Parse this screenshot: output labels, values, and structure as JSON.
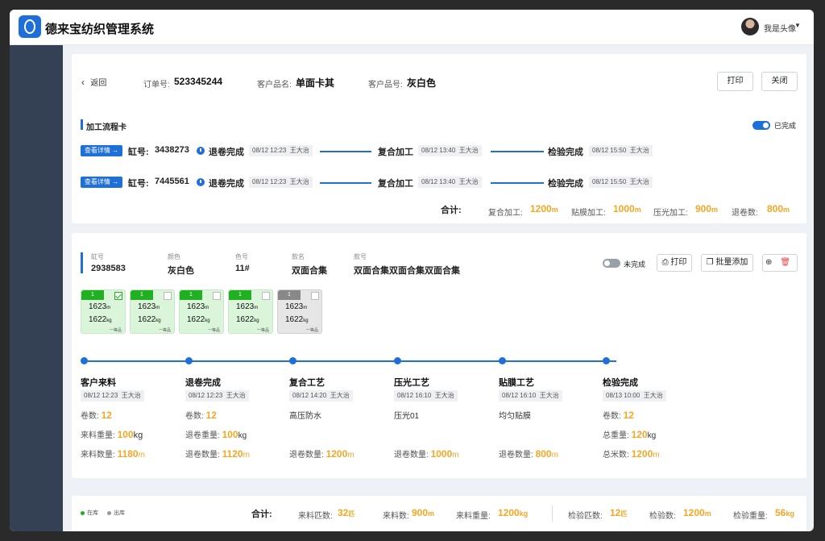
{
  "app": {
    "title": "德来宝纺织管理系统",
    "user": "我是头像"
  },
  "order": {
    "back_label": "返回",
    "order_no_label": "订单号:",
    "order_no": "523345244",
    "product_name_label": "客户品名:",
    "product_name": "单面卡其",
    "product_code_label": "客户品号:",
    "product_code": "灰白色",
    "print_label": "打印",
    "close_label": "关闭"
  },
  "process_card": {
    "title": "加工流程卡",
    "toggle_label": "已完成",
    "rows": [
      {
        "detail_btn": "查看详情 →",
        "vat_label": "缸号:",
        "vat_no": "3438273",
        "steps": [
          {
            "name": "退卷完成",
            "time": "08/12 12:23",
            "person": "王大治"
          },
          {
            "name": "复合加工",
            "time": "08/12 13:40",
            "person": "王大治"
          },
          {
            "name": "检验完成",
            "time": "08/12 15:50",
            "person": "王大治"
          }
        ]
      },
      {
        "detail_btn": "查看详情 →",
        "vat_label": "缸号:",
        "vat_no": "7445561",
        "steps": [
          {
            "name": "退卷完成",
            "time": "08/12 12:23",
            "person": "王大治"
          },
          {
            "name": "复合加工",
            "time": "08/12 13:40",
            "person": "王大治"
          },
          {
            "name": "检验完成",
            "time": "08/12 15:50",
            "person": "王大治"
          }
        ]
      }
    ],
    "total_label": "合计:",
    "totals": [
      {
        "label": "复合加工:",
        "value": "1200",
        "unit": "m"
      },
      {
        "label": "贴膜加工:",
        "value": "1000",
        "unit": "m"
      },
      {
        "label": "压光加工:",
        "value": "900",
        "unit": "m"
      },
      {
        "label": "退卷数:",
        "value": "800",
        "unit": "m"
      }
    ]
  },
  "vat_detail": {
    "fields": [
      {
        "label": "缸号",
        "value": "2938583"
      },
      {
        "label": "颜色",
        "value": "灰白色"
      },
      {
        "label": "色号",
        "value": "11#"
      },
      {
        "label": "款名",
        "value": "双面合集"
      },
      {
        "label": "款号",
        "value": "双面合集双面合集双面合集"
      }
    ],
    "toggle_label": "未完成",
    "print_label": "打印",
    "batch_add_label": "批量添加",
    "rolls": [
      {
        "num": "1",
        "length": "1623",
        "len_unit": "m",
        "weight": "1622",
        "wt_unit": "kg",
        "grade": "一等品",
        "checked": true,
        "status": "green"
      },
      {
        "num": "1",
        "length": "1623",
        "len_unit": "m",
        "weight": "1622",
        "wt_unit": "kg",
        "grade": "一等品",
        "checked": false,
        "status": "green"
      },
      {
        "num": "1",
        "length": "1623",
        "len_unit": "m",
        "weight": "1622",
        "wt_unit": "kg",
        "grade": "一等品",
        "checked": false,
        "status": "green"
      },
      {
        "num": "1",
        "length": "1623",
        "len_unit": "m",
        "weight": "1622",
        "wt_unit": "kg",
        "grade": "一等品",
        "checked": false,
        "status": "green"
      },
      {
        "num": "1",
        "length": "1623",
        "len_unit": "m",
        "weight": "1622",
        "wt_unit": "kg",
        "grade": "一等品",
        "checked": false,
        "status": "gray"
      }
    ],
    "steps": [
      {
        "title": "客户来料",
        "time": "08/12 12:23",
        "person": "王大治",
        "lines": [
          {
            "label": "卷数:",
            "value": "12",
            "unit": ""
          },
          {
            "label": "来料重量:",
            "value": "100",
            "unit": "kg"
          },
          {
            "label": "来料数量:",
            "value": "1180",
            "unit": "m"
          }
        ]
      },
      {
        "title": "退卷完成",
        "time": "08/12 12:23",
        "person": "王大治",
        "lines": [
          {
            "label": "卷数:",
            "value": "12",
            "unit": ""
          },
          {
            "label": "退卷重量:",
            "value": "100",
            "unit": "kg"
          },
          {
            "label": "退卷数量:",
            "value": "1120",
            "unit": "m"
          }
        ]
      },
      {
        "title": "复合工艺",
        "time": "08/12 14:20",
        "person": "王大治",
        "note": "高压防水",
        "lines": [
          {
            "label": "退卷数量:",
            "value": "1200",
            "unit": "m"
          }
        ]
      },
      {
        "title": "压光工艺",
        "time": "08/12 16:10",
        "person": "王大治",
        "note": "压光01",
        "lines": [
          {
            "label": "退卷数量:",
            "value": "1000",
            "unit": "m"
          }
        ]
      },
      {
        "title": "贴膜工艺",
        "time": "08/12 16:10",
        "person": "王大治",
        "note": "均匀贴膜",
        "lines": [
          {
            "label": "退卷数量:",
            "value": "800",
            "unit": "m"
          }
        ]
      },
      {
        "title": "检验完成",
        "time": "08/13 10:00",
        "person": "王大治",
        "lines": [
          {
            "label": "卷数:",
            "value": "12",
            "unit": ""
          },
          {
            "label": "总重量:",
            "value": "120",
            "unit": "kg"
          },
          {
            "label": "总米数:",
            "value": "1200",
            "unit": "m"
          }
        ]
      }
    ]
  },
  "footer": {
    "legend_in": "在库",
    "legend_out": "出库",
    "total_label": "合计:",
    "totals": [
      {
        "label": "来料匹数:",
        "value": "32",
        "unit": "匹"
      },
      {
        "label": "来料数:",
        "value": "900",
        "unit": "m"
      },
      {
        "label": "来料重量:",
        "value": "1200",
        "unit": "kg"
      },
      {
        "label": "检验匹数:",
        "value": "12",
        "unit": "匹"
      },
      {
        "label": "检验数:",
        "value": "1200",
        "unit": "m"
      },
      {
        "label": "检验重量:",
        "value": "56",
        "unit": "kg"
      }
    ]
  },
  "colors": {
    "accent": "#1f6fd9",
    "highlight": "#f5a623",
    "sidebar": "#344155",
    "in_stock": "#21b021",
    "out_stock": "#999999"
  }
}
